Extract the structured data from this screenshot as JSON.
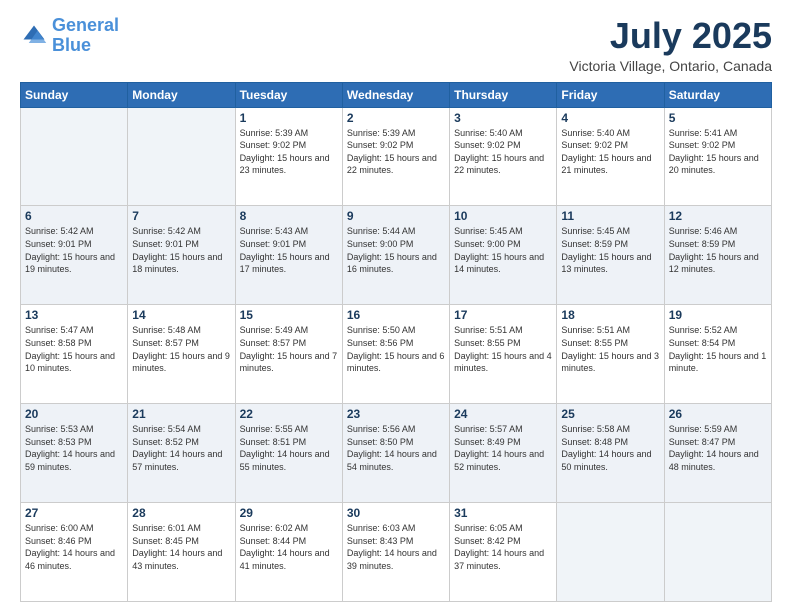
{
  "logo": {
    "line1": "General",
    "line2": "Blue"
  },
  "title": "July 2025",
  "subtitle": "Victoria Village, Ontario, Canada",
  "days_of_week": [
    "Sunday",
    "Monday",
    "Tuesday",
    "Wednesday",
    "Thursday",
    "Friday",
    "Saturday"
  ],
  "weeks": [
    [
      {
        "day": "",
        "info": ""
      },
      {
        "day": "",
        "info": ""
      },
      {
        "day": "1",
        "info": "Sunrise: 5:39 AM\nSunset: 9:02 PM\nDaylight: 15 hours and 23 minutes."
      },
      {
        "day": "2",
        "info": "Sunrise: 5:39 AM\nSunset: 9:02 PM\nDaylight: 15 hours and 22 minutes."
      },
      {
        "day": "3",
        "info": "Sunrise: 5:40 AM\nSunset: 9:02 PM\nDaylight: 15 hours and 22 minutes."
      },
      {
        "day": "4",
        "info": "Sunrise: 5:40 AM\nSunset: 9:02 PM\nDaylight: 15 hours and 21 minutes."
      },
      {
        "day": "5",
        "info": "Sunrise: 5:41 AM\nSunset: 9:02 PM\nDaylight: 15 hours and 20 minutes."
      }
    ],
    [
      {
        "day": "6",
        "info": "Sunrise: 5:42 AM\nSunset: 9:01 PM\nDaylight: 15 hours and 19 minutes."
      },
      {
        "day": "7",
        "info": "Sunrise: 5:42 AM\nSunset: 9:01 PM\nDaylight: 15 hours and 18 minutes."
      },
      {
        "day": "8",
        "info": "Sunrise: 5:43 AM\nSunset: 9:01 PM\nDaylight: 15 hours and 17 minutes."
      },
      {
        "day": "9",
        "info": "Sunrise: 5:44 AM\nSunset: 9:00 PM\nDaylight: 15 hours and 16 minutes."
      },
      {
        "day": "10",
        "info": "Sunrise: 5:45 AM\nSunset: 9:00 PM\nDaylight: 15 hours and 14 minutes."
      },
      {
        "day": "11",
        "info": "Sunrise: 5:45 AM\nSunset: 8:59 PM\nDaylight: 15 hours and 13 minutes."
      },
      {
        "day": "12",
        "info": "Sunrise: 5:46 AM\nSunset: 8:59 PM\nDaylight: 15 hours and 12 minutes."
      }
    ],
    [
      {
        "day": "13",
        "info": "Sunrise: 5:47 AM\nSunset: 8:58 PM\nDaylight: 15 hours and 10 minutes."
      },
      {
        "day": "14",
        "info": "Sunrise: 5:48 AM\nSunset: 8:57 PM\nDaylight: 15 hours and 9 minutes."
      },
      {
        "day": "15",
        "info": "Sunrise: 5:49 AM\nSunset: 8:57 PM\nDaylight: 15 hours and 7 minutes."
      },
      {
        "day": "16",
        "info": "Sunrise: 5:50 AM\nSunset: 8:56 PM\nDaylight: 15 hours and 6 minutes."
      },
      {
        "day": "17",
        "info": "Sunrise: 5:51 AM\nSunset: 8:55 PM\nDaylight: 15 hours and 4 minutes."
      },
      {
        "day": "18",
        "info": "Sunrise: 5:51 AM\nSunset: 8:55 PM\nDaylight: 15 hours and 3 minutes."
      },
      {
        "day": "19",
        "info": "Sunrise: 5:52 AM\nSunset: 8:54 PM\nDaylight: 15 hours and 1 minute."
      }
    ],
    [
      {
        "day": "20",
        "info": "Sunrise: 5:53 AM\nSunset: 8:53 PM\nDaylight: 14 hours and 59 minutes."
      },
      {
        "day": "21",
        "info": "Sunrise: 5:54 AM\nSunset: 8:52 PM\nDaylight: 14 hours and 57 minutes."
      },
      {
        "day": "22",
        "info": "Sunrise: 5:55 AM\nSunset: 8:51 PM\nDaylight: 14 hours and 55 minutes."
      },
      {
        "day": "23",
        "info": "Sunrise: 5:56 AM\nSunset: 8:50 PM\nDaylight: 14 hours and 54 minutes."
      },
      {
        "day": "24",
        "info": "Sunrise: 5:57 AM\nSunset: 8:49 PM\nDaylight: 14 hours and 52 minutes."
      },
      {
        "day": "25",
        "info": "Sunrise: 5:58 AM\nSunset: 8:48 PM\nDaylight: 14 hours and 50 minutes."
      },
      {
        "day": "26",
        "info": "Sunrise: 5:59 AM\nSunset: 8:47 PM\nDaylight: 14 hours and 48 minutes."
      }
    ],
    [
      {
        "day": "27",
        "info": "Sunrise: 6:00 AM\nSunset: 8:46 PM\nDaylight: 14 hours and 46 minutes."
      },
      {
        "day": "28",
        "info": "Sunrise: 6:01 AM\nSunset: 8:45 PM\nDaylight: 14 hours and 43 minutes."
      },
      {
        "day": "29",
        "info": "Sunrise: 6:02 AM\nSunset: 8:44 PM\nDaylight: 14 hours and 41 minutes."
      },
      {
        "day": "30",
        "info": "Sunrise: 6:03 AM\nSunset: 8:43 PM\nDaylight: 14 hours and 39 minutes."
      },
      {
        "day": "31",
        "info": "Sunrise: 6:05 AM\nSunset: 8:42 PM\nDaylight: 14 hours and 37 minutes."
      },
      {
        "day": "",
        "info": ""
      },
      {
        "day": "",
        "info": ""
      }
    ]
  ]
}
